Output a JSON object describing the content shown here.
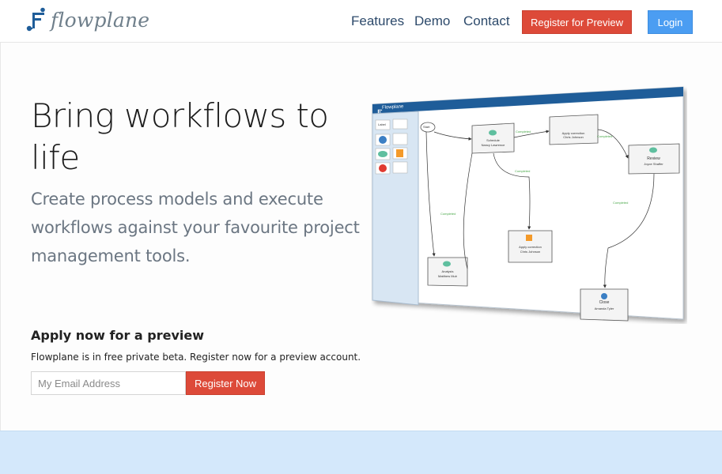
{
  "brand": {
    "name": "flowplane"
  },
  "nav": {
    "features": "Features",
    "demo": "Demo",
    "contact": "Contact",
    "register_preview": "Register for Preview",
    "login": "Login"
  },
  "hero": {
    "title": "Bring workflows to life",
    "subtitle": "Create process models and execute workflows against your favourite project management tools.",
    "apply_heading": "Apply now for a preview",
    "apply_text": "Flowplane is in free private beta. Register now for a preview account.",
    "email_placeholder": "My Email Address",
    "register_button": "Register Now"
  },
  "mockup": {
    "app_title": "Flowplane",
    "palette_label": "Label",
    "nodes": {
      "start": "Start",
      "schedule": [
        "Schedule",
        "Nancy Lawrence"
      ],
      "apply1": [
        "Apply correction",
        "Chris Johnson"
      ],
      "review": [
        "Review",
        "Joyce Shaffer"
      ],
      "analysis": [
        "Analysis",
        "Matthew Muir"
      ],
      "apply2": [
        "Apply correction",
        "Chris Johnson"
      ],
      "close": [
        "Close",
        "Amanda Tyler"
      ]
    },
    "edge_label": "Completed"
  },
  "colors": {
    "accent_red": "#dd4a39",
    "accent_blue": "#4b9df2",
    "band_blue": "#d4e8fb",
    "titlebar_blue": "#1f5d99"
  }
}
